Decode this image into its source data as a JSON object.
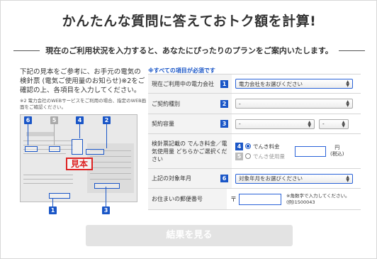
{
  "header": {
    "title": "かんたんな質問に答えておトク額を計算!",
    "subtitle": "現在のご利用状況を入力すると、あなたにぴったりのプランをご案内いたします。"
  },
  "left": {
    "description": "下記の見本をご参考に、お手元の電気の検針票 (電気ご使用量のお知らせ)※2をご確認の上、各項目を入力してください。",
    "note": "※2 電力会社のWEBサービスをご利用の場合、指定のWEB画面をご確認ください。",
    "sample_stamp": "見本",
    "badges": [
      "6",
      "5",
      "4",
      "2",
      "1",
      "3"
    ]
  },
  "form": {
    "required_note": "※すべての項目が必須です",
    "rows": [
      {
        "label": "現在ご利用中の電力会社",
        "num": "1",
        "select": "電力会社をお選びください"
      },
      {
        "label": "ご契約種別",
        "num": "2",
        "select": "-"
      },
      {
        "label": "契約容量",
        "num": "3",
        "select_a": "-",
        "select_b": "-"
      },
      {
        "label": "検針票記載の でんき料金／電気使用量 どちらかご選択ください",
        "num_a": "4",
        "num_b": "5",
        "radio_a": "でんき料金",
        "radio_b": "でんき使用量",
        "unit_a": "円",
        "unit_b": "(税込)"
      },
      {
        "label": "上記の対象年月",
        "num": "6",
        "select": "対象年月をお選びください"
      },
      {
        "label": "お住まいの郵便番号",
        "prefix": "〒",
        "hint": "※角数字で入力してください。(例)1500043"
      }
    ]
  },
  "submit": {
    "label": "結果を見る"
  },
  "colors": {
    "accent": "#1a56c7",
    "button_disabled": "#e3e3e3"
  }
}
